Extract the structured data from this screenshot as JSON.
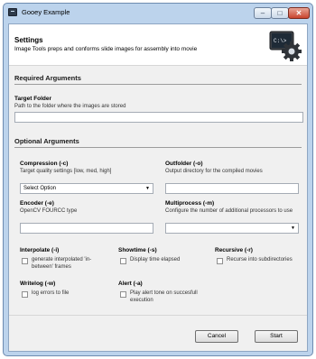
{
  "window": {
    "title": "Gooey Example",
    "controls": {
      "minimize": "–",
      "maximize": "□",
      "close": "✕"
    }
  },
  "header": {
    "title": "Settings",
    "subtitle": "Image Tools preps and conforms slide images for assembly into movie",
    "logo_icon": "terminal-gear-icon",
    "logo_text": "C:\\>"
  },
  "required": {
    "section_title": "Required Arguments",
    "target_folder": {
      "label": "Target Folder",
      "help": "Path to the folder where the images are stored",
      "value": ""
    }
  },
  "optional": {
    "section_title": "Optional Arguments",
    "compression": {
      "label": "Compression (-c)",
      "help": "Target quality settings [low, med, high]",
      "selected": "Select Option"
    },
    "outfolder": {
      "label": "Outfolder (-o)",
      "help": "Output directory for the compiled movies",
      "value": ""
    },
    "encoder": {
      "label": "Encoder (-e)",
      "help": "OpenCV FOURCC type",
      "value": ""
    },
    "multiprocess": {
      "label": "Multiprocess (-m)",
      "help": "Configure the number of additional processors to use",
      "selected": ""
    },
    "interpolate": {
      "label": "Interpolate (-i)",
      "help": "generate interpolated 'in-between' frames",
      "checked": false
    },
    "showtime": {
      "label": "Showtime (-s)",
      "help": "Display time elapsed",
      "checked": false
    },
    "recursive": {
      "label": "Recursive (-r)",
      "help": "Recurse into subdirectories",
      "checked": false
    },
    "writelog": {
      "label": "Writelog (-w)",
      "help": "log errors to file",
      "checked": false
    },
    "alert": {
      "label": "Alert (-a)",
      "help": "Play alert tone on succesfull execution",
      "checked": false
    }
  },
  "footer": {
    "cancel_label": "Cancel",
    "start_label": "Start"
  },
  "icons": {
    "dropdown": "chevron-down-icon"
  },
  "colors": {
    "window_frame": "#bcd3ec",
    "client_bg": "#f0f0f0",
    "header_bg": "#ffffff"
  }
}
